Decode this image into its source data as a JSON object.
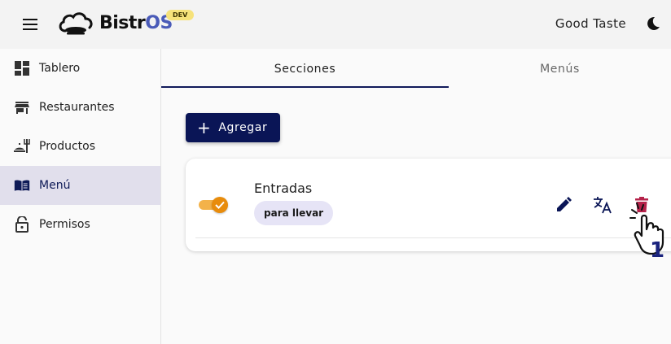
{
  "app": {
    "brand_prefix": "Bistr",
    "brand_suffix": "OS",
    "env_badge": "DEV",
    "user_name": "Good Taste"
  },
  "sidebar": {
    "items": [
      {
        "label": "Tablero",
        "icon": "dashboard-icon",
        "active": false
      },
      {
        "label": "Restaurantes",
        "icon": "store-icon",
        "active": false
      },
      {
        "label": "Productos",
        "icon": "food-icon",
        "active": false
      },
      {
        "label": "Menú",
        "icon": "menu-book-icon",
        "active": true
      },
      {
        "label": "Permisos",
        "icon": "lock-icon",
        "active": false
      }
    ]
  },
  "tabs": [
    {
      "label": "Secciones",
      "active": true
    },
    {
      "label": "Menús",
      "active": false
    }
  ],
  "actions": {
    "add_label": "Agregar"
  },
  "sections": [
    {
      "title": "Entradas",
      "tag": "para llevar",
      "enabled": true
    }
  ],
  "annotation": {
    "step_number": "1"
  },
  "colors": {
    "primary": "#0a1556",
    "accent": "#e88c0c",
    "delete": "#b5224a",
    "active_nav": "#e1dfec"
  }
}
